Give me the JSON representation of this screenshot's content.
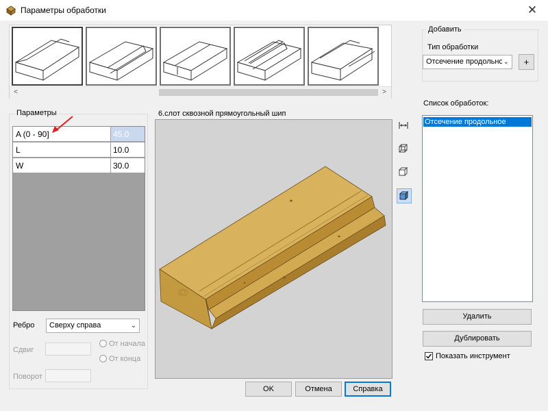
{
  "window": {
    "title": "Параметры обработки",
    "close_glyph": "✕"
  },
  "gallery": {
    "thumbnails": [
      {
        "name": "processing-type-1",
        "selected": true
      },
      {
        "name": "processing-type-2",
        "selected": false
      },
      {
        "name": "processing-type-3",
        "selected": false
      },
      {
        "name": "processing-type-4",
        "selected": false
      },
      {
        "name": "processing-type-5",
        "selected": false
      }
    ],
    "scroll_left": "<",
    "scroll_right": ">"
  },
  "params": {
    "label": "Параметры",
    "rows": [
      {
        "name": "A (0 - 90]",
        "value": "45.0"
      },
      {
        "name": "L",
        "value": "10.0"
      },
      {
        "name": "W",
        "value": "30.0"
      }
    ],
    "edge_label": "Ребро",
    "edge_value": "Сверху справа",
    "shift_label": "Сдвиг",
    "rotation_label": "Поворот",
    "from_start": "От начала",
    "from_end": "От конца"
  },
  "viewport": {
    "caption": "6.слот сквозной прямоугольный шип"
  },
  "add": {
    "group_label": "Добавить",
    "type_label": "Тип обработки",
    "type_value": "Отсечение продольное",
    "plus": "+"
  },
  "list": {
    "label": "Список обработок:",
    "items": [
      "Отсечение продольное"
    ]
  },
  "buttons": {
    "delete": "Удалить",
    "duplicate": "Дублировать",
    "show_tool": "Показать инструмент",
    "ok": "OK",
    "cancel": "Отмена",
    "help": "Справка"
  },
  "colors": {
    "wood_top": "#d7b05a",
    "wood_front": "#c49a3f",
    "selection": "#0078d7",
    "viewport_bg": "#d3d3d3"
  }
}
